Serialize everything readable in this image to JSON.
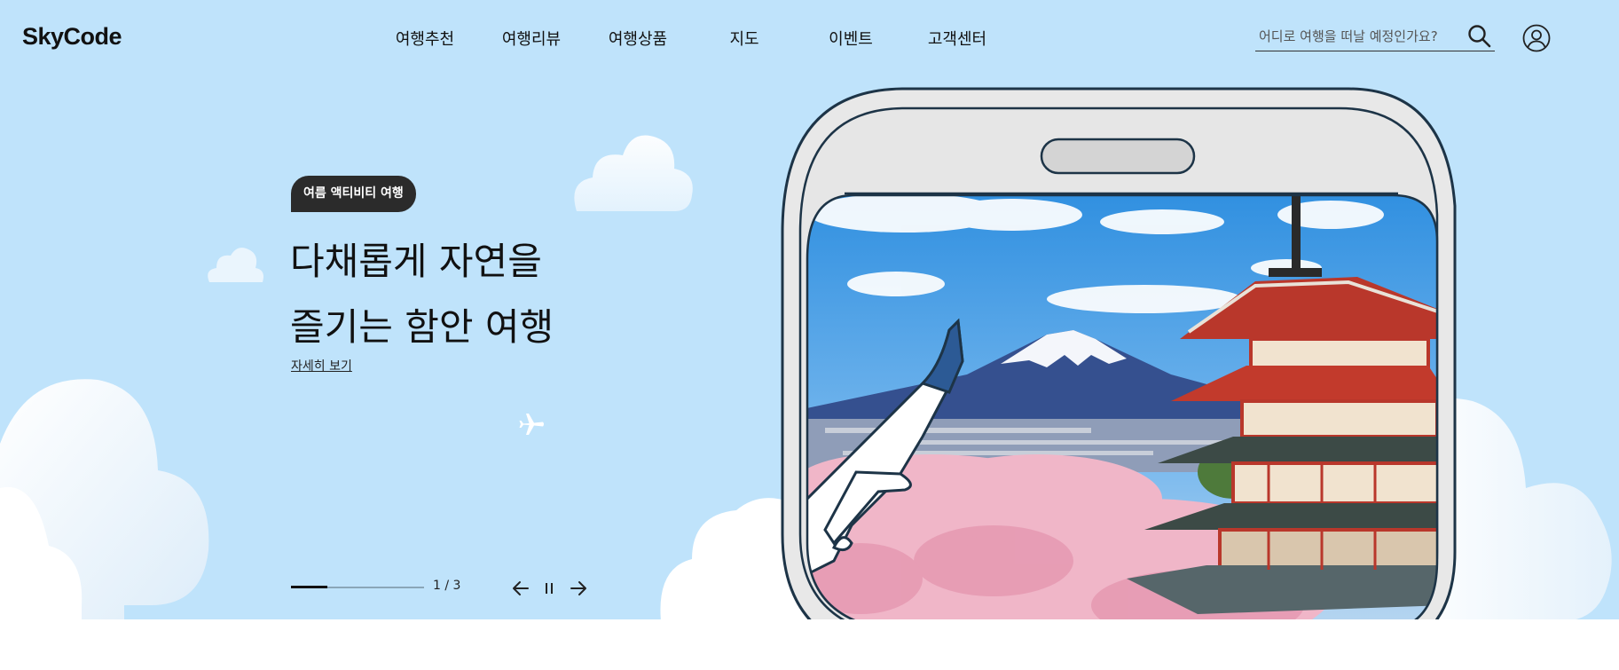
{
  "header": {
    "logo": "SkyCode",
    "nav": [
      {
        "label": "여행추천"
      },
      {
        "label": "여행리뷰"
      },
      {
        "label": "여행상품"
      },
      {
        "label": "지도"
      },
      {
        "label": "이벤트"
      },
      {
        "label": "고객센터"
      }
    ],
    "search": {
      "placeholder": "어디로 여행을 떠날 예정인가요?",
      "icon": "search-icon"
    },
    "user_icon": "user-icon"
  },
  "hero": {
    "badge": "여름 액티비티 여행",
    "headline_line1": "다채롭게 자연을",
    "headline_line2": "즐기는 함안 여행",
    "detail_link": "자세히 보기",
    "slider": {
      "current": 1,
      "total": 3,
      "counter_text": "1 / 3",
      "progress": 0.27
    }
  },
  "colors": {
    "sky": "#bfe3fb",
    "badge_bg": "#2b2b2b",
    "window_frame": "#1d3447"
  }
}
